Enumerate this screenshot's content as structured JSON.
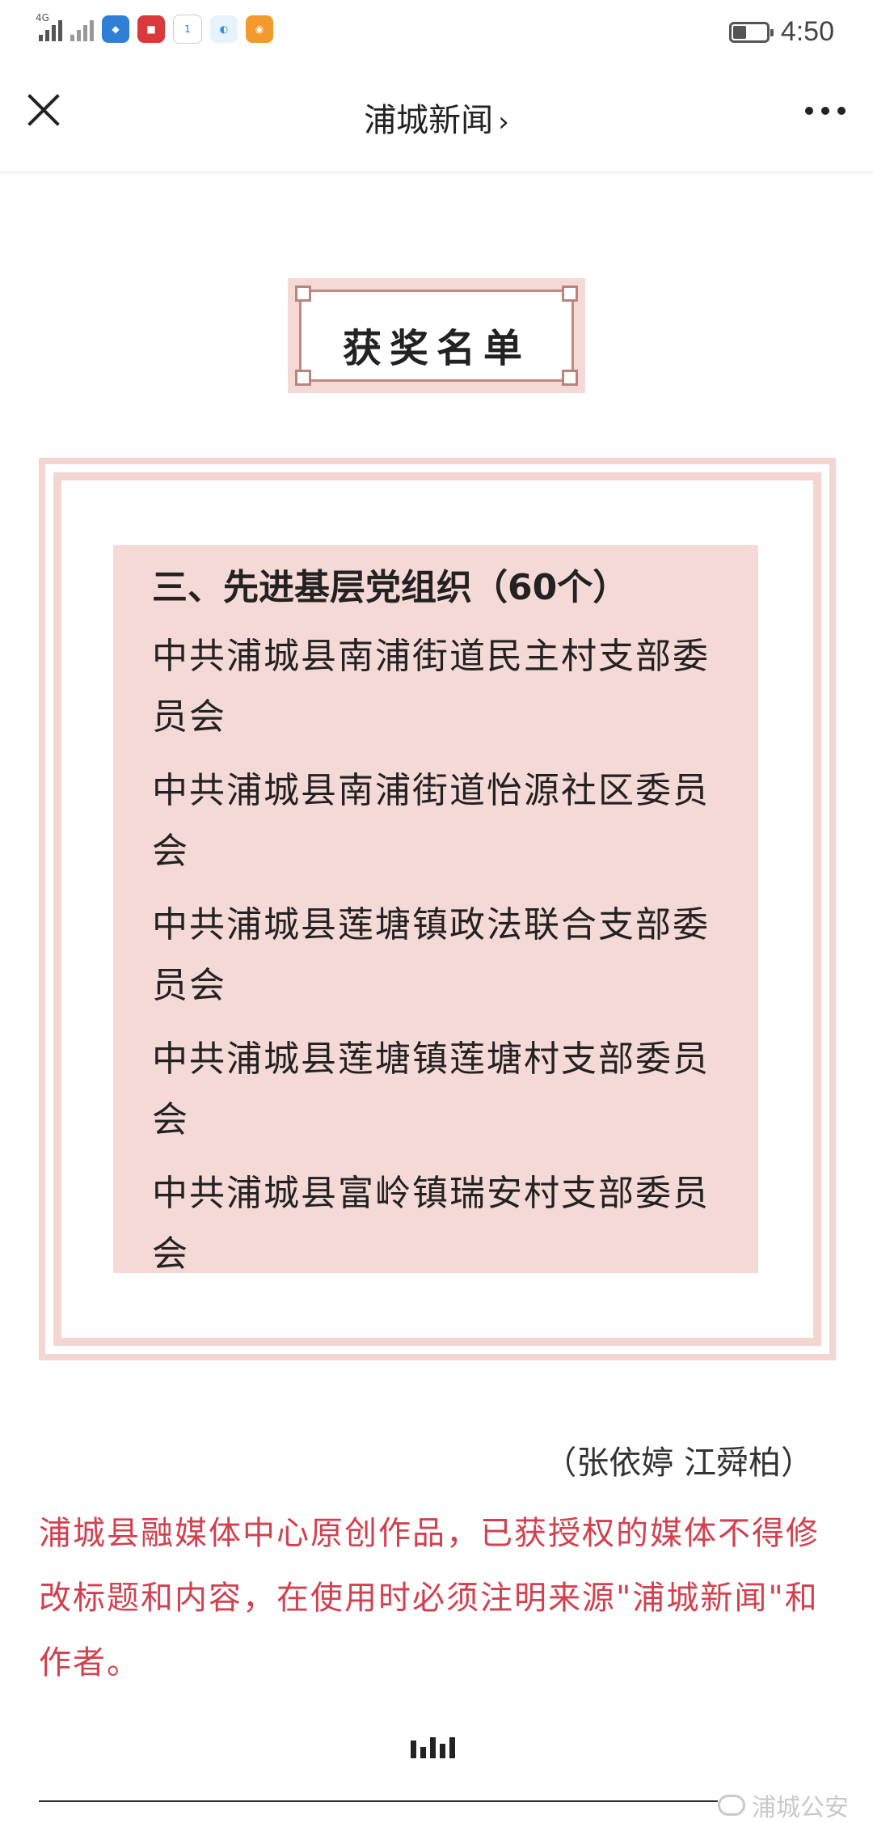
{
  "status_bar": {
    "time": "4:50",
    "network_label": "4G",
    "battery_level": 0.4,
    "notification_icons": [
      "news-app-icon",
      "zhejiang-app-icon",
      "1t-app-icon",
      "browser-app-icon",
      "uc-app-icon"
    ]
  },
  "nav": {
    "title": "浦城新闻",
    "chevron": "›"
  },
  "header": {
    "text": "获奖名单"
  },
  "list": {
    "title": "三、先进基层党组织（60个）",
    "items": [
      "中共浦城县南浦街道民主村支部委员会",
      "中共浦城县南浦街道怡源社区委员会",
      "中共浦城县莲塘镇政法联合支部委员会",
      "中共浦城县莲塘镇莲塘村支部委员会",
      "中共浦城县富岭镇瑞安村支部委员会"
    ]
  },
  "byline": "（张依婷 江舜柏）",
  "notice": "浦城县融媒体中心原创作品，已获授权的媒体不得修改标题和内容，在使用时必须注明来源\"浦城新闻\"和作者。",
  "watermark": "浦城公安",
  "colors": {
    "accent_pink": "#f5d9d7",
    "frame_brown": "#c08a84",
    "notice_red": "#d2414f"
  }
}
